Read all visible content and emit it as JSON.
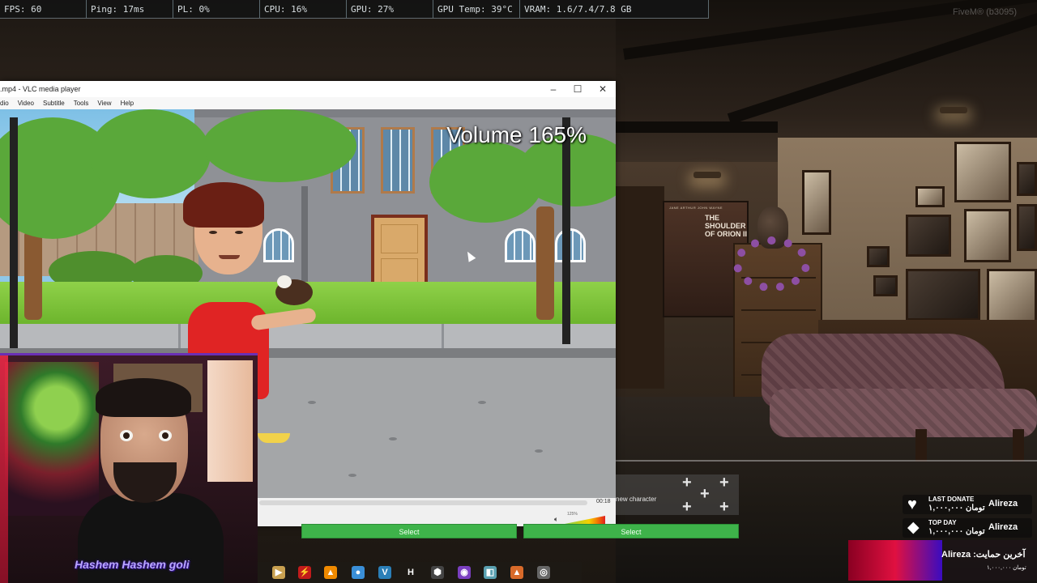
{
  "perf": {
    "fps": "FPS: 60",
    "ping": "Ping: 17ms",
    "pl": "PL: 0%",
    "cpu": "CPU: 16%",
    "gpu": "GPU: 27%",
    "gpu_temp": "GPU Temp: 39°C",
    "vram": "VRAM: 1.6/7.4/7.8 GB"
  },
  "build_label": "FiveM® (b3095)",
  "vlc": {
    "title": ".mp4 - VLC media player",
    "menu": [
      "dio",
      "Video",
      "Subtitle",
      "Tools",
      "View",
      "Help"
    ],
    "osd_volume": "Volume 165%",
    "time": "00:18",
    "volume_small": "125%",
    "progress": 0.0
  },
  "poster": {
    "credits": "JANE ARTHUR   JOHN WAYNE",
    "title": "THE SHOULDER OF ORION II"
  },
  "char_select": {
    "select_left": "Select",
    "select_right": "Select",
    "new_character": "new character"
  },
  "webcam": {
    "streamer_name": "Hashem Hashem goli"
  },
  "donations": {
    "last_title": "LAST DONATE",
    "last_amount": "۱,۰۰۰,۰۰۰ تومان",
    "last_name": "Alireza",
    "top_title": "TOP DAY",
    "top_amount": "۱,۰۰۰,۰۰۰ تومان",
    "top_name": "Alireza",
    "support_title": "آخرین حمایت: Alireza",
    "support_amount": "۱,۰۰۰,۰۰۰ تومان"
  },
  "icons": {
    "heart": "heart-icon",
    "diamond": "diamond-icon",
    "plus": "plus-icon",
    "speaker": "speaker-icon"
  },
  "taskbar": {
    "h_label": "H"
  }
}
